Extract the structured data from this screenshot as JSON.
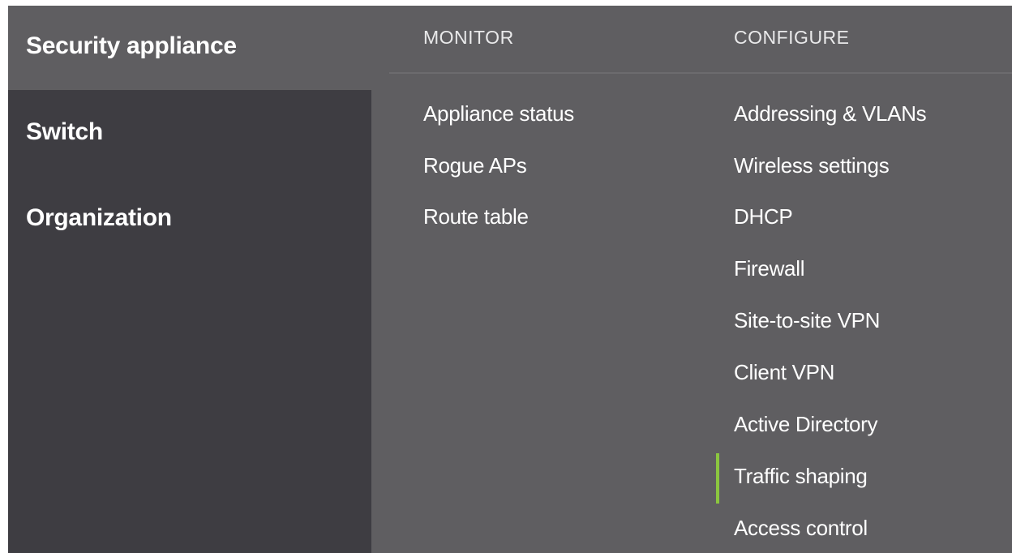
{
  "sidebar": {
    "items": [
      {
        "label": "Security appliance",
        "active": true
      },
      {
        "label": "Switch",
        "active": false
      },
      {
        "label": "Organization",
        "active": false
      }
    ]
  },
  "monitor": {
    "heading": "MONITOR",
    "items": [
      "Appliance status",
      "Rogue APs",
      "Route table"
    ]
  },
  "configure": {
    "heading": "CONFIGURE",
    "items": [
      "Addressing & VLANs",
      "Wireless settings",
      "DHCP",
      "Firewall",
      "Site-to-site VPN",
      "Client VPN",
      "Active Directory",
      "Traffic shaping",
      "Access control"
    ],
    "selected": "Traffic shaping"
  },
  "colors": {
    "background": "#5f5e61",
    "sidebar": "#3e3d42",
    "accent": "#8bc63f"
  }
}
